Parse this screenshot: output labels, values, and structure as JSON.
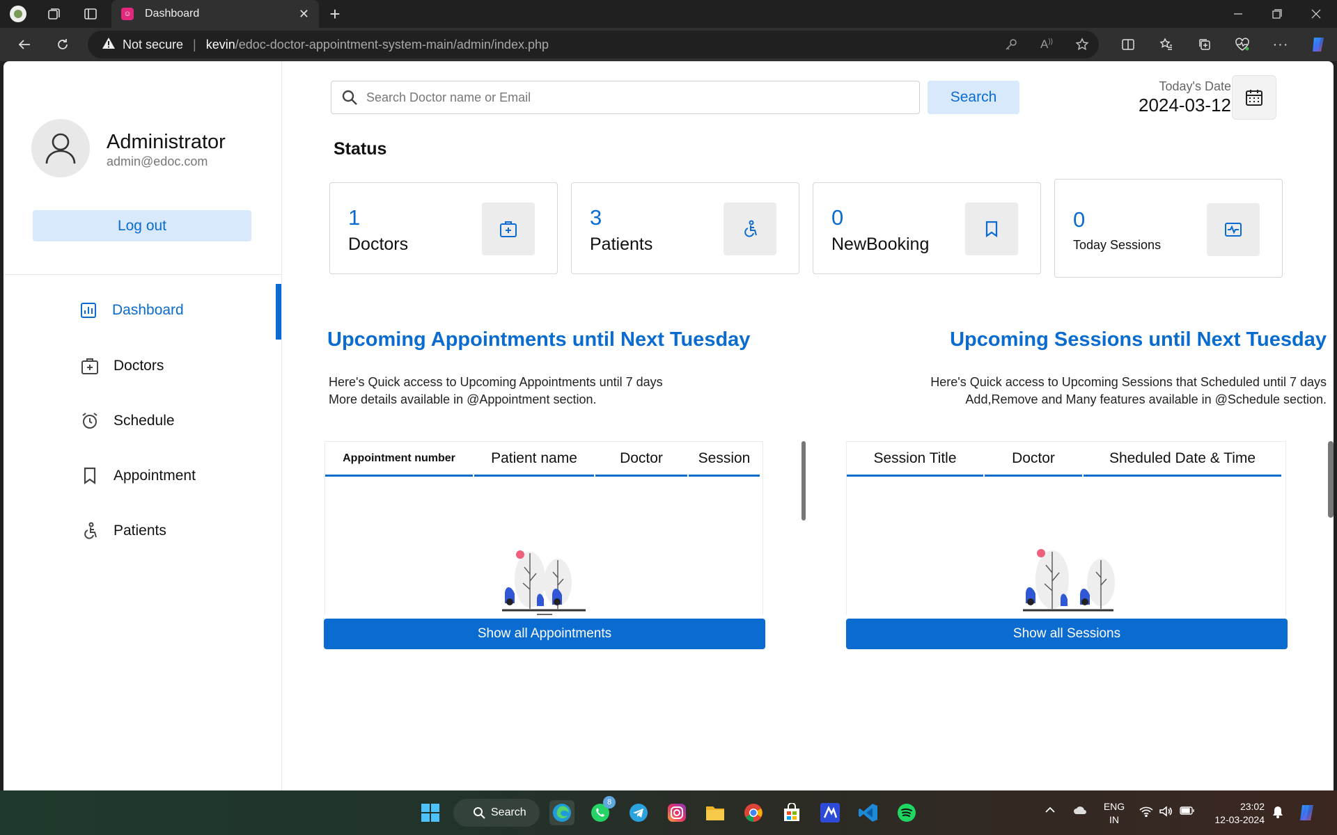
{
  "browser": {
    "tab_title": "Dashboard",
    "security_label": "Not secure",
    "url_host": "kevin",
    "url_path": "/edoc-doctor-appointment-system-main/admin/index.php"
  },
  "sidebar": {
    "user_name": "Administrator",
    "user_email": "admin@edoc.com",
    "logout_label": "Log out",
    "menu": [
      {
        "label": "Dashboard",
        "icon": "dashboard-icon",
        "active": true
      },
      {
        "label": "Doctors",
        "icon": "doctor-icon",
        "active": false
      },
      {
        "label": "Schedule",
        "icon": "schedule-icon",
        "active": false
      },
      {
        "label": "Appointment",
        "icon": "bookmark-icon",
        "active": false
      },
      {
        "label": "Patients",
        "icon": "patient-icon",
        "active": false
      }
    ]
  },
  "header": {
    "search_placeholder": "Search Doctor name or Email",
    "search_button": "Search",
    "date_label": "Today's Date",
    "date_value": "2024-03-12"
  },
  "status": {
    "title": "Status",
    "cards": [
      {
        "count": "1",
        "label": "Doctors",
        "icon": "doctor-icon"
      },
      {
        "count": "3",
        "label": "Patients",
        "icon": "patient-icon"
      },
      {
        "count": "0",
        "label": "NewBooking",
        "icon": "bookmark-icon"
      },
      {
        "count": "0",
        "label": "Today Sessions",
        "icon": "session-icon"
      }
    ]
  },
  "appointments": {
    "title": "Upcoming Appointments until Next Tuesday",
    "desc_line1": "Here's Quick access to Upcoming Appointments until 7 days",
    "desc_line2": "More details available in @Appointment section.",
    "columns": [
      "Appointment number",
      "Patient name",
      "Doctor",
      "Session"
    ],
    "button": "Show all Appointments"
  },
  "sessions": {
    "title": "Upcoming Sessions until Next Tuesday",
    "desc_line1": "Here's Quick access to Upcoming Sessions that Scheduled until 7 days",
    "desc_line2": "Add,Remove and Many features available in @Schedule section.",
    "columns": [
      "Session Title",
      "Doctor",
      "Sheduled Date & Time"
    ],
    "button": "Show all Sessions"
  },
  "taskbar": {
    "search_label": "Search",
    "whatsapp_badge": "8",
    "lang_line1": "ENG",
    "lang_line2": "IN",
    "time": "23:02",
    "date": "12-03-2024"
  },
  "colors": {
    "accent": "#0a6bd0",
    "accent_light": "#d8e9fb"
  }
}
